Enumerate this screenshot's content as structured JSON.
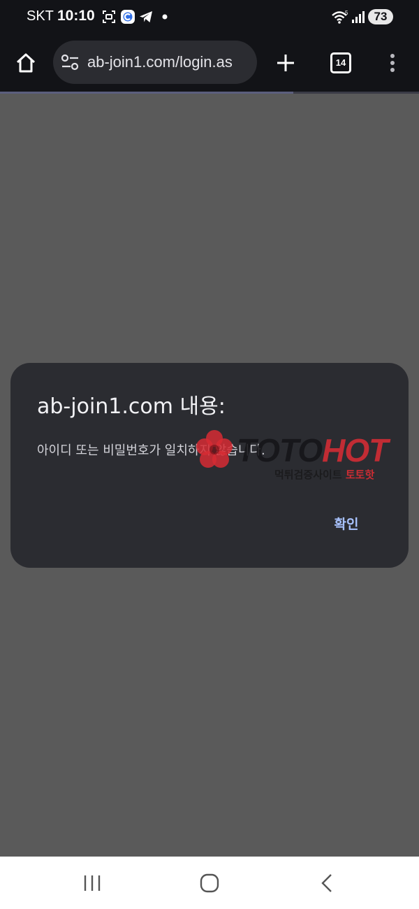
{
  "status_bar": {
    "carrier": "SKT",
    "time": "10:10",
    "battery_level": "73",
    "notification_icons": [
      "screenshot-icon",
      "c-app-icon",
      "telegram-icon",
      "dot-icon"
    ],
    "system_icons": [
      "wifi-icon",
      "signal-icon"
    ]
  },
  "browser": {
    "url": "ab-join1.com/login.as",
    "tab_count": "14",
    "toolbar_icons": [
      "home-icon",
      "site-settings-icon",
      "new-tab-icon",
      "tab-switcher-icon",
      "menu-icon"
    ],
    "load_progress": 0.7
  },
  "dialog": {
    "title": "ab-join1.com 내용:",
    "message": "아이디 또는 비밀번호가 일치하지 않습니다.",
    "ok_label": "확인"
  },
  "watermark": {
    "brand_part1": "TOTO",
    "brand_part2": "HOT",
    "tagline_part1": "먹튀검증사이트",
    "tagline_part2": "토토핫"
  },
  "navigation_bar": {
    "icons": [
      "recent-apps-icon",
      "home-button-icon",
      "back-icon"
    ]
  },
  "colors": {
    "chrome_bg": "#121317",
    "page_overlay": "#5a5a5a",
    "dialog_bg": "#2b2c31",
    "dialog_button": "#a9c3ff",
    "watermark_red": "#d62c34"
  }
}
